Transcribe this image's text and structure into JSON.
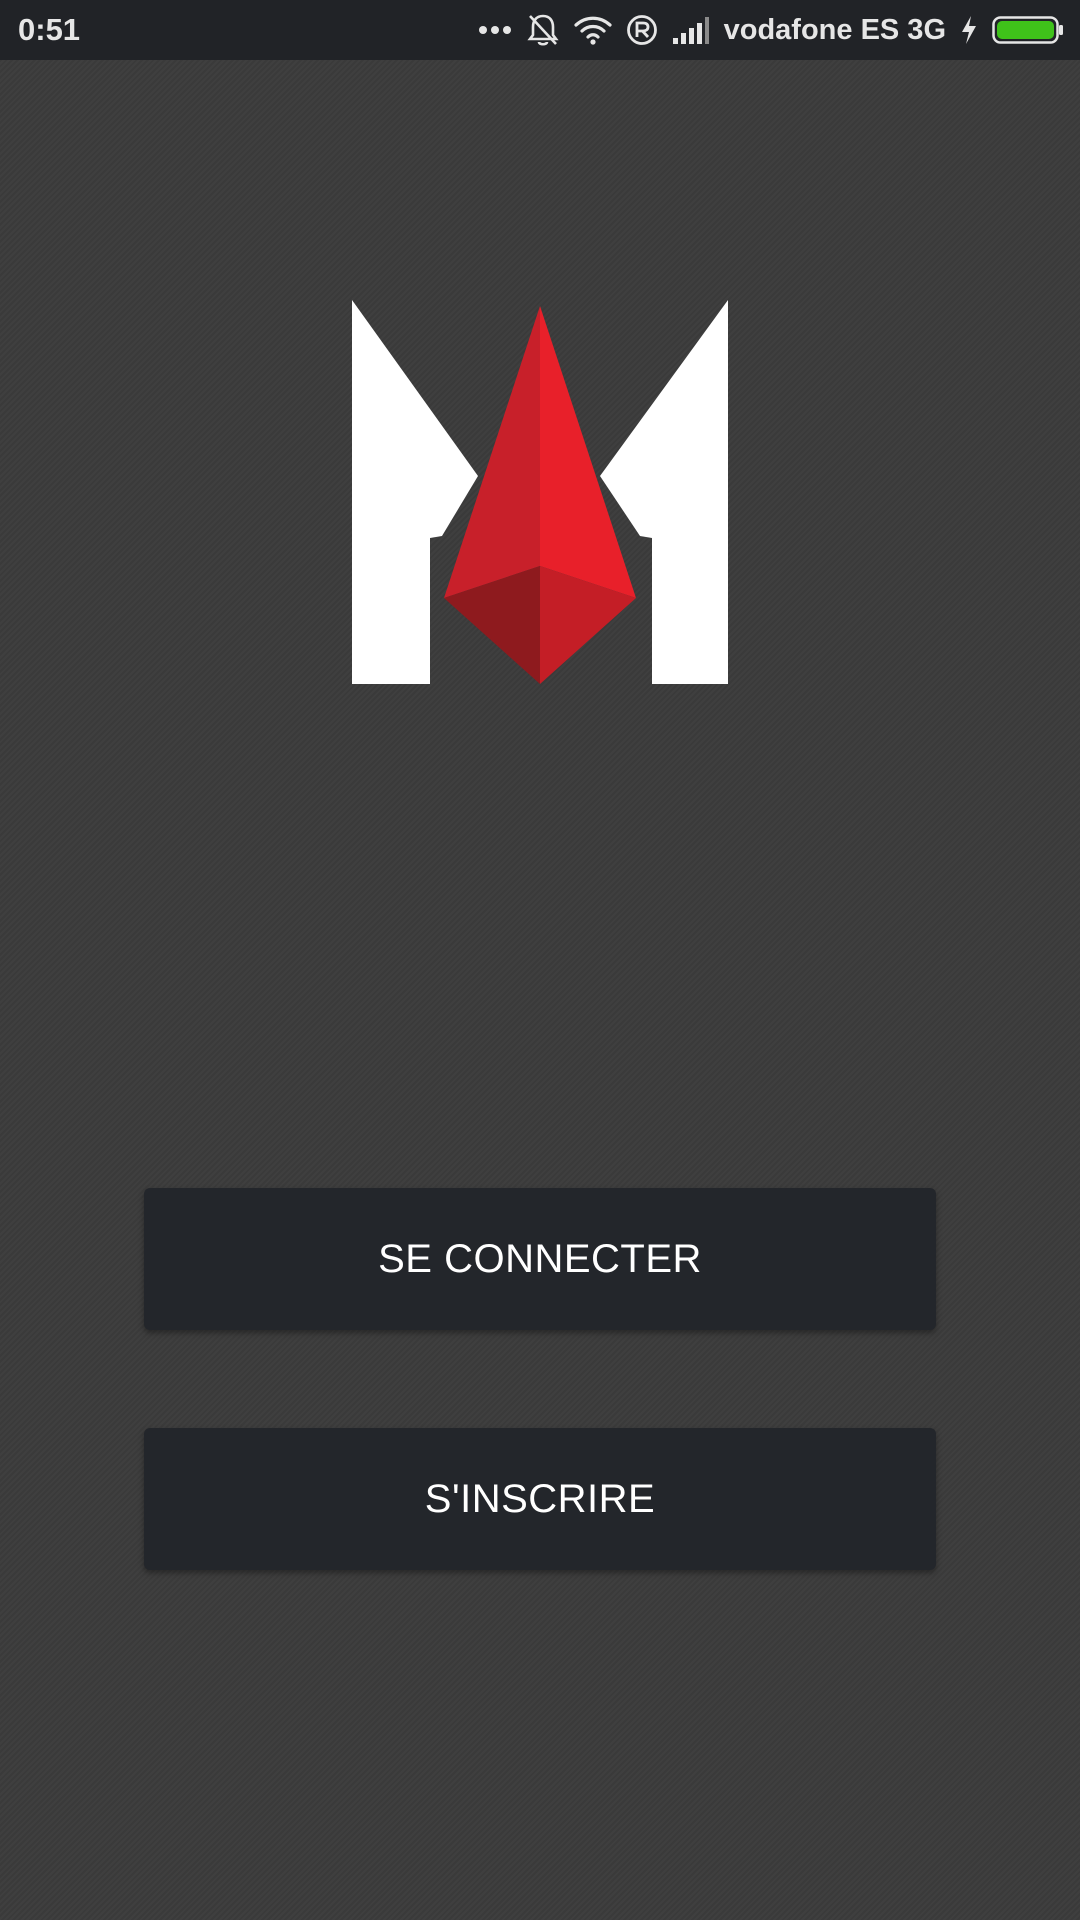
{
  "status_bar": {
    "time": "0:51",
    "carrier": "vodafone ES 3G",
    "icons": [
      "more-dots-icon",
      "bell-muted-icon",
      "wifi-icon",
      "registered-icon",
      "signal-icon",
      "charging-bolt-icon",
      "battery-icon"
    ],
    "battery_level": 1.0,
    "battery_color": "#3fc21a"
  },
  "logo": {
    "icon": "m-logo-icon",
    "colors": {
      "letter": "#ffffff",
      "gem_light": "#e8202a",
      "gem_mid": "#c41e26",
      "gem_dark": "#8e1a1e"
    }
  },
  "buttons": {
    "login_label": "SE CONNECTER",
    "register_label": "S'INSCRIRE"
  },
  "theme": {
    "background": "#3b3b3b",
    "button_bg": "#23262b",
    "status_bg": "#212327"
  }
}
